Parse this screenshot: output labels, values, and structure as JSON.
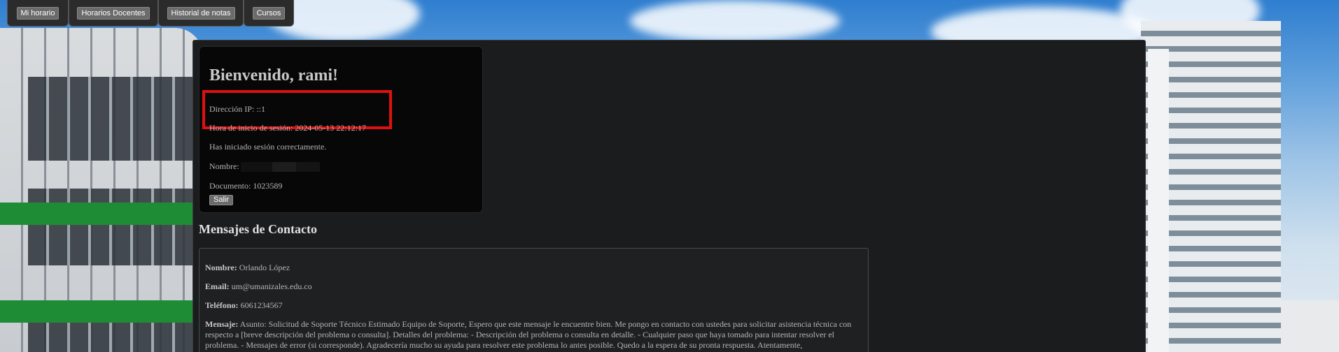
{
  "nav": {
    "items": [
      "Mi horario",
      "Horarios Docentes",
      "Historial de notas",
      "Cursos"
    ]
  },
  "welcome": {
    "title": "Bienvenido, rami!",
    "ip_label": "Dirección IP: ::1",
    "login_time": "Hora de inicio de sesión: 2024-05-13 22:12:17",
    "success": "Has iniciado sesión correctamente.",
    "name_label": "Nombre:",
    "document": "Documento: 1023589",
    "logout_label": "Salir"
  },
  "messages": {
    "title": "Mensajes de Contacto",
    "items": [
      {
        "name_label": "Nombre:",
        "name": "Orlando López",
        "email_label": "Email:",
        "email": "um@umanizales.edu.co",
        "phone_label": "Teléfono:",
        "phone": "6061234567",
        "message_label": "Mensaje:",
        "message": "Asunto: Solicitud de Soporte Técnico Estimado Equipo de Soporte, Espero que este mensaje le encuentre bien. Me pongo en contacto con ustedes para solicitar asistencia técnica con respecto a [breve descripción del problema o consulta]. Detalles del problema: - Descripción del problema o consulta en detalle. - Cualquier paso que haya tomado para intentar resolver el problema. - Mensajes de error (si corresponde). Agradecería mucho su ayuda para resolver este problema lo antes posible. Quedo a la espera de su pronta respuesta. Atentamente,"
      }
    ]
  },
  "colors": {
    "highlight": "#e01010",
    "panel": "#1b1c1e",
    "card": "#070707"
  }
}
